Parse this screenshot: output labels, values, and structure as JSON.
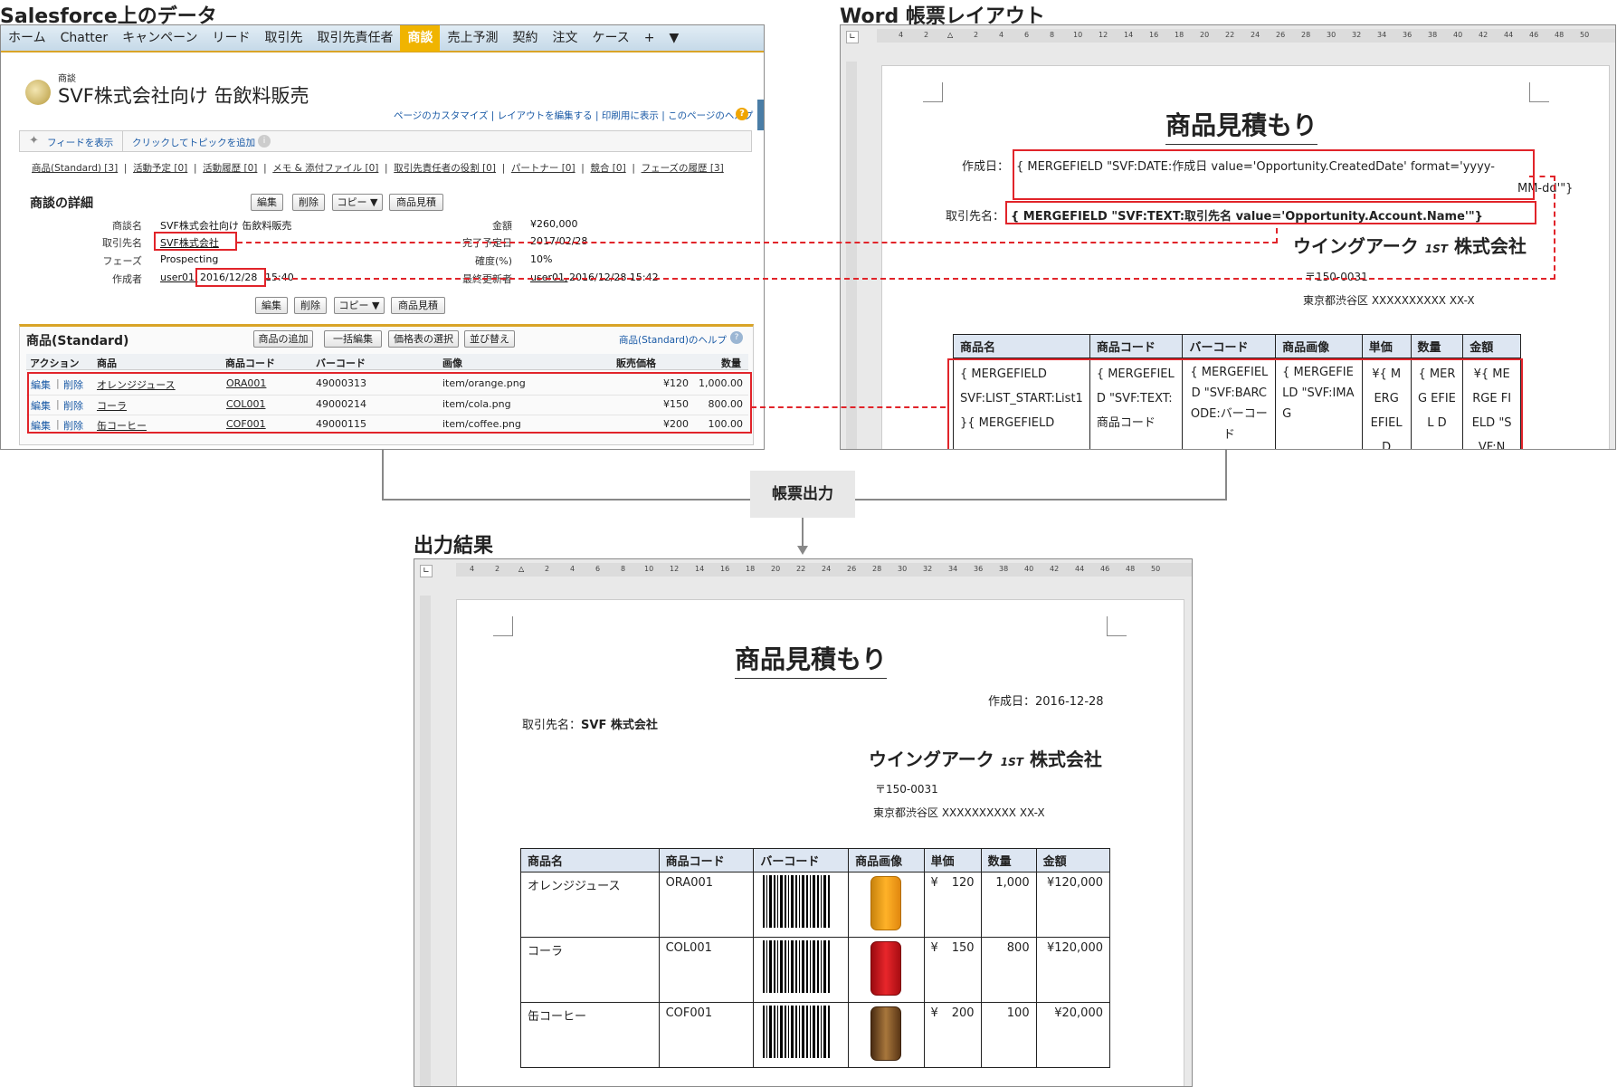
{
  "sections": {
    "salesforce_title": "Salesforce上のデータ",
    "word_title": "Word 帳票レイアウト",
    "output_title": "出力結果",
    "arrow_label": "帳票出力"
  },
  "salesforce": {
    "tabs": [
      "ホーム",
      "Chatter",
      "キャンペーン",
      "リード",
      "取引先",
      "取引先責任者",
      "商談",
      "売上予測",
      "契約",
      "注文",
      "ケース",
      "+",
      "▼"
    ],
    "record_type": "商談",
    "record_name": "SVF株式会社向け 缶飲料販売",
    "top_links": "ページのカスタマイズ | レイアウトを編集する | 印刷用に表示 | このページのヘルプ",
    "feed_show": "フィードを表示",
    "feed_topic": "クリックしてトピックを追加",
    "related_links": [
      "商品(Standard) [3]",
      "活動予定 [0]",
      "活動履歴 [0]",
      "メモ & 添付ファイル [0]",
      "取引先責任者の役割 [0]",
      "パートナー [0]",
      "競合 [0]",
      "フェーズの履歴 [3]"
    ],
    "detail_title": "商談の詳細",
    "buttons": [
      "編集",
      "削除",
      "コピー ▼",
      "商品見積"
    ],
    "fields": {
      "name_label": "商談名",
      "name_value": "SVF株式会社向け 缶飲料販売",
      "account_label": "取引先名",
      "account_value": "SVF株式会社",
      "phase_label": "フェーズ",
      "phase_value": "Prospecting",
      "creator_label": "作成者",
      "creator_user": "user01,",
      "creator_date": "2016/12/28",
      "creator_time": "15:40",
      "amount_label": "金額",
      "amount_value": "¥260,000",
      "close_label": "完了予定日",
      "close_value": "2017/02/28",
      "prob_label": "確度(%)",
      "prob_value": "10%",
      "modified_label": "最終更新者",
      "modified_user": "user01,",
      "modified_value": "2016/12/28 15:42"
    },
    "products_title": "商品(Standard)",
    "products_buttons": [
      "商品の追加",
      "一括編集",
      "価格表の選択",
      "並び替え"
    ],
    "products_help": "商品(Standard)のヘルプ",
    "columns": [
      "アクション",
      "商品",
      "商品コード",
      "バーコード",
      "画像",
      "販売価格",
      "数量"
    ],
    "rows": [
      {
        "action_edit": "編集",
        "action_del": "削除",
        "name": "オレンジジュース",
        "code": "ORA001",
        "barcode": "49000313",
        "image": "item/orange.png",
        "price": "¥120",
        "qty": "1,000.00"
      },
      {
        "action_edit": "編集",
        "action_del": "削除",
        "name": "コーラ",
        "code": "COL001",
        "barcode": "49000214",
        "image": "item/cola.png",
        "price": "¥150",
        "qty": "800.00"
      },
      {
        "action_edit": "編集",
        "action_del": "削除",
        "name": "缶コーヒー",
        "code": "COF001",
        "barcode": "49000115",
        "image": "item/coffee.png",
        "price": "¥200",
        "qty": "100.00"
      }
    ]
  },
  "word": {
    "ruler": [
      "4",
      "2",
      "",
      "2",
      "4",
      "6",
      "8",
      "10",
      "12",
      "14",
      "16",
      "18",
      "20",
      "22",
      "24",
      "26",
      "28",
      "30",
      "32",
      "34",
      "36",
      "38",
      "40",
      "42",
      "44",
      "46",
      "48",
      "50"
    ],
    "doc_title": "商品見積もり",
    "date_label": "作成日：",
    "date_field_1": "{ MERGEFIELD \"SVF:DATE:作成日 value='Opportunity.CreatedDate' format='yyyy-",
    "date_field_2": "MM-dd'\"}",
    "account_label": "取引先名：",
    "account_field": "{ MERGEFIELD \"SVF:TEXT:取引先名 value='Opportunity.Account.Name'\"}",
    "company": "ウイングアーク",
    "company_logo": "1ST",
    "company_suffix": "株式会社",
    "zip": "〒150-0031",
    "address": "東京都渋谷区 XXXXXXXXXX XX-X",
    "columns": [
      "商品名",
      "商品コード",
      "バーコード",
      "商品画像",
      "単価",
      "数量",
      "金額"
    ],
    "cells": [
      "{ MERGEFIELD SVF:LIST_START:List1 }{ MERGEFIELD",
      "{ MERGEFIELD \"SVF:TEXT: 商品コード",
      "{ MERGEFIELD \"SVF:BARCODE:バーコード",
      "{ MERGEFIELD \"SVF:IMAG",
      "¥{ MERG EFIELD",
      "{ MERG EFIEL D",
      "¥{ MERGE FIELD \"SVF:N"
    ]
  },
  "output": {
    "doc_title": "商品見積もり",
    "date": "作成日：2016-12-28",
    "account_label": "取引先名：",
    "account_value": "SVF 株式会社",
    "company": "ウイングアーク",
    "company_logo": "1ST",
    "company_suffix": "株式会社",
    "zip": "〒150-0031",
    "address": "東京都渋谷区 XXXXXXXXXX XX-X",
    "columns": [
      "商品名",
      "商品コード",
      "バーコード",
      "商品画像",
      "単価",
      "数量",
      "金額"
    ],
    "rows": [
      {
        "name": "オレンジジュース",
        "code": "ORA001",
        "image": "orange-can-icon",
        "yen": "¥",
        "price": "120",
        "qty": "1,000",
        "amount": "¥120,000"
      },
      {
        "name": "コーラ",
        "code": "COL001",
        "image": "cola-can-icon",
        "yen": "¥",
        "price": "150",
        "qty": "800",
        "amount": "¥120,000"
      },
      {
        "name": "缶コーヒー",
        "code": "COF001",
        "image": "coffee-can-icon",
        "yen": "¥",
        "price": "200",
        "qty": "100",
        "amount": "¥20,000"
      }
    ]
  },
  "colors": {
    "accent_red": "#e1242a",
    "header_blue": "#dde6f2",
    "sf_tab_active": "#f0b400"
  }
}
